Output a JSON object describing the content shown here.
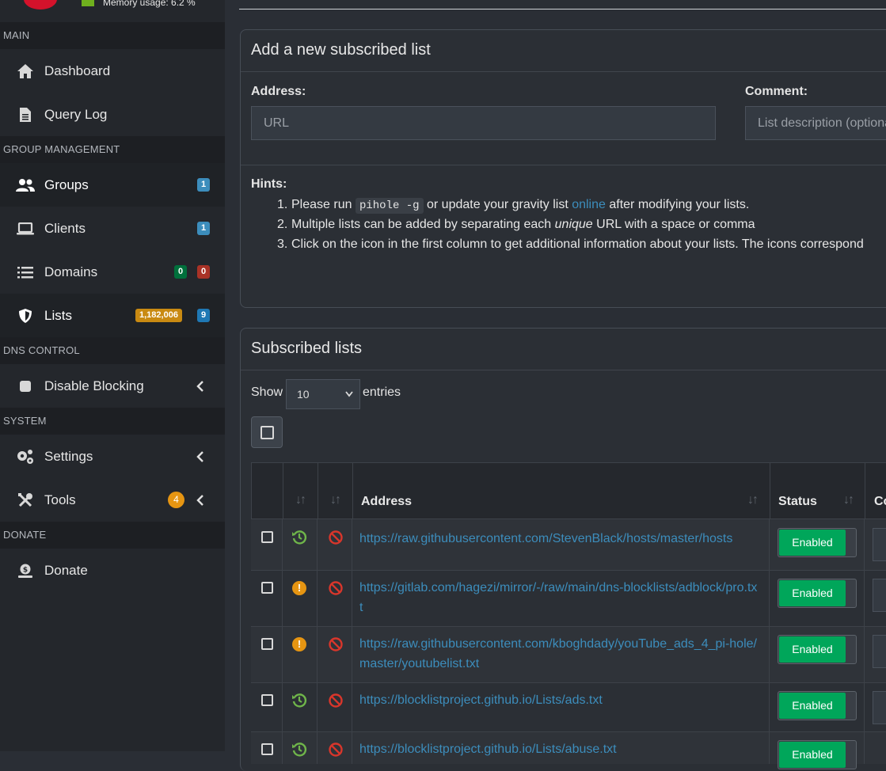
{
  "header": {
    "memory_usage": "Memory usage: 6.2 %"
  },
  "sidebar": {
    "sections": {
      "main": "MAIN",
      "group_management": "GROUP MANAGEMENT",
      "dns_control": "DNS CONTROL",
      "system": "SYSTEM",
      "donate": "DONATE"
    },
    "items": {
      "dashboard": "Dashboard",
      "query_log": "Query Log",
      "groups": "Groups",
      "clients": "Clients",
      "domains": "Domains",
      "lists": "Lists",
      "disable_blocking": "Disable Blocking",
      "settings": "Settings",
      "tools": "Tools",
      "donate": "Donate"
    },
    "badges": {
      "groups": "1",
      "clients": "1",
      "domains_allow": "0",
      "domains_deny": "0",
      "lists_domains": "1,182,006",
      "lists_count": "9",
      "tools": "4"
    },
    "colors": {
      "blue_badge": "#3c8dbc",
      "green_badge": "#00703c",
      "red_badge": "#a93226",
      "gold_badge": "#c98a12",
      "orange": "#e69512"
    }
  },
  "add_card": {
    "title": "Add a new subscribed list",
    "address_label": "Address:",
    "address_placeholder": "URL",
    "comment_label": "Comment:",
    "comment_placeholder": "List description (optional)",
    "hints_title": "Hints:",
    "hint1_pre": "Please run ",
    "hint1_code": "pihole -g",
    "hint1_mid": " or update your gravity list ",
    "hint1_link": "online",
    "hint1_post": " after modifying your lists.",
    "hint2_pre": "Multiple lists can be added by separating each ",
    "hint2_em": "unique",
    "hint2_post": " URL with a space or comma",
    "hint3": "Click on the icon in the first column to get additional information about your lists. The icons correspond"
  },
  "lists_card": {
    "title": "Subscribed lists",
    "show_label": "Show",
    "page_size": "10",
    "entries_label": "entries",
    "columns": {
      "address": "Address",
      "status": "Status",
      "comment": "Co"
    },
    "rows": [
      {
        "status_icon": "history-icon",
        "address": "https://raw.githubusercontent.com/StevenBlack/hosts/master/hosts",
        "enabled": "Enabled"
      },
      {
        "status_icon": "warning-icon",
        "address": "https://gitlab.com/hagezi/mirror/-/raw/main/dns-blocklists/adblock/pro.txt",
        "enabled": "Enabled"
      },
      {
        "status_icon": "warning-icon",
        "address": "https://raw.githubusercontent.com/kboghdady/youTube_ads_4_pi-hole/master/youtubelist.txt",
        "enabled": "Enabled"
      },
      {
        "status_icon": "history-icon",
        "address": "https://blocklistproject.github.io/Lists/ads.txt",
        "enabled": "Enabled"
      },
      {
        "status_icon": "history-icon",
        "address": "https://blocklistproject.github.io/Lists/abuse.txt",
        "enabled": "Enabled"
      }
    ]
  }
}
